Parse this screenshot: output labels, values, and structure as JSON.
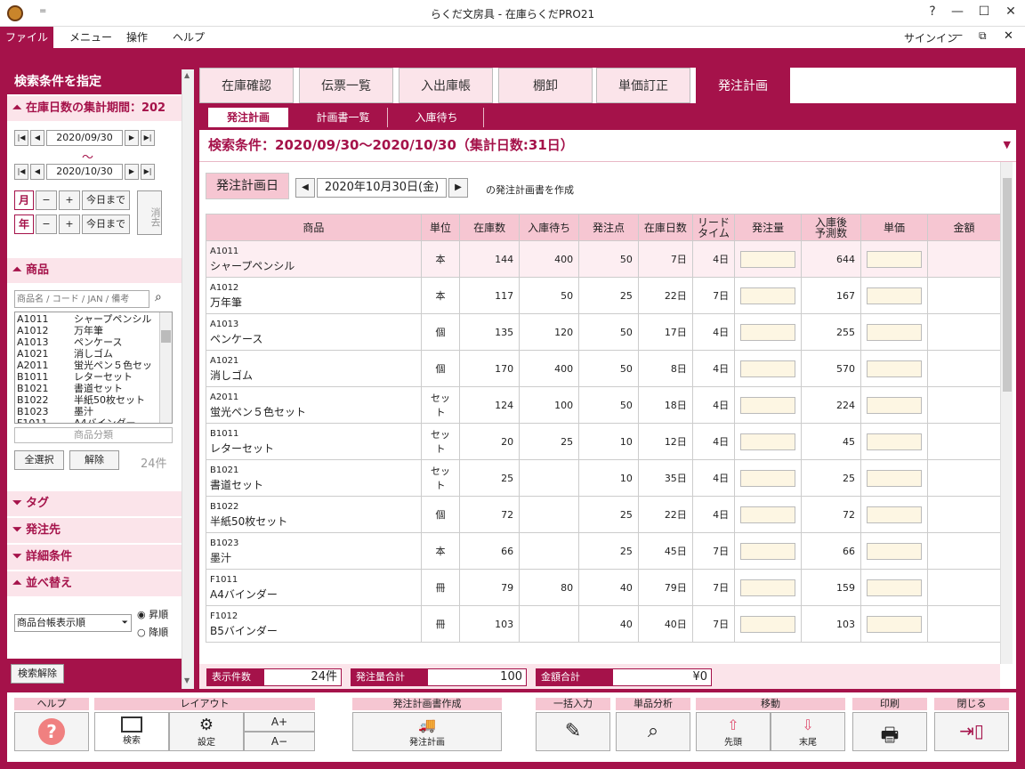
{
  "window": {
    "title": "らくだ文房具 - 在庫らくだPRO21",
    "signin": "サインイン",
    "help": "?",
    "minimize": "—",
    "maximize": "☐",
    "close": "✕",
    "restore": "⧉",
    "qa": "="
  },
  "menubar": {
    "items": [
      "ファイル",
      "メニュー",
      "操作",
      "ヘルプ"
    ]
  },
  "left": {
    "header": "検索条件を指定",
    "period_title": "在庫日数の集計期間：202",
    "date_from": "2020/09/30",
    "date_to": "2020/10/30",
    "tilde": "～",
    "month": "月",
    "year": "年",
    "minus": "−",
    "plus": "+",
    "today": "今日まで",
    "clear": "消去",
    "product_title": "商品",
    "search_placeholder": "商品名 / コード / JAN / 備考",
    "products": [
      [
        "A1011",
        "シャープペンシル"
      ],
      [
        "A1012",
        "万年筆"
      ],
      [
        "A1013",
        "ペンケース"
      ],
      [
        "A1021",
        "消しゴム"
      ],
      [
        "A2011",
        "蛍光ペン５色セッ"
      ],
      [
        "B1011",
        "レターセット"
      ],
      [
        "B1021",
        "書道セット"
      ],
      [
        "B1022",
        "半紙50枚セット"
      ],
      [
        "B1023",
        "墨汁"
      ],
      [
        "F1011",
        "A4バインダー"
      ]
    ],
    "category_placeholder": "商品分類",
    "select_all": "全選択",
    "release": "解除",
    "count": "24件",
    "tag": "タグ",
    "supplier": "発注先",
    "detail": "詳細条件",
    "sort": "並べ替え",
    "sort_value": "商品台帳表示順",
    "asc": "昇順",
    "desc": "降順",
    "reset_search": "検索解除"
  },
  "tabs": [
    "在庫確認",
    "伝票一覧",
    "入出庫帳",
    "棚卸",
    "単価訂正",
    "発注計画"
  ],
  "subtabs": [
    "発注計画",
    "計画書一覧",
    "入庫待ち"
  ],
  "condition": "検索条件：2020/09/30～2020/10/30（集計日数:31日）",
  "plan": {
    "label": "発注計画日",
    "date": "2020年10月30日(金)",
    "suffix": "の発注計画書を作成"
  },
  "table": {
    "headers": [
      "商品",
      "単位",
      "在庫数",
      "入庫待ち",
      "発注点",
      "在庫日数",
      "リード\nタイム",
      "発注量",
      "入庫後\n予測数",
      "単価",
      "金額"
    ],
    "rows": [
      {
        "code": "A1011",
        "name": "シャープペンシル",
        "unit": "本",
        "stock": "144",
        "wait": "400",
        "point": "50",
        "days": "7日",
        "lead": "4日",
        "forecast": "644"
      },
      {
        "code": "A1012",
        "name": "万年筆",
        "unit": "本",
        "stock": "117",
        "wait": "50",
        "point": "25",
        "days": "22日",
        "lead": "7日",
        "forecast": "167"
      },
      {
        "code": "A1013",
        "name": "ペンケース",
        "unit": "個",
        "stock": "135",
        "wait": "120",
        "point": "50",
        "days": "17日",
        "lead": "4日",
        "forecast": "255"
      },
      {
        "code": "A1021",
        "name": "消しゴム",
        "unit": "個",
        "stock": "170",
        "wait": "400",
        "point": "50",
        "days": "8日",
        "lead": "4日",
        "forecast": "570"
      },
      {
        "code": "A2011",
        "name": "蛍光ペン５色セット",
        "unit": "セット",
        "stock": "124",
        "wait": "100",
        "point": "50",
        "days": "18日",
        "lead": "4日",
        "forecast": "224"
      },
      {
        "code": "B1011",
        "name": "レターセット",
        "unit": "セット",
        "stock": "20",
        "wait": "25",
        "point": "10",
        "days": "12日",
        "lead": "4日",
        "forecast": "45"
      },
      {
        "code": "B1021",
        "name": "書道セット",
        "unit": "セット",
        "stock": "25",
        "wait": "",
        "point": "10",
        "days": "35日",
        "lead": "4日",
        "forecast": "25"
      },
      {
        "code": "B1022",
        "name": "半紙50枚セット",
        "unit": "個",
        "stock": "72",
        "wait": "",
        "point": "25",
        "days": "22日",
        "lead": "4日",
        "forecast": "72"
      },
      {
        "code": "B1023",
        "name": "墨汁",
        "unit": "本",
        "stock": "66",
        "wait": "",
        "point": "25",
        "days": "45日",
        "lead": "7日",
        "forecast": "66"
      },
      {
        "code": "F1011",
        "name": "A4バインダー",
        "unit": "冊",
        "stock": "79",
        "wait": "80",
        "point": "40",
        "days": "79日",
        "lead": "7日",
        "forecast": "159"
      },
      {
        "code": "F1012",
        "name": "B5バインダー",
        "unit": "冊",
        "stock": "103",
        "wait": "",
        "point": "40",
        "days": "40日",
        "lead": "7日",
        "forecast": "103"
      }
    ]
  },
  "status": {
    "count_label": "表示件数",
    "count": "24件",
    "qty_label": "発注量合計",
    "qty": "100",
    "amount_label": "金額合計",
    "amount": "¥0"
  },
  "bottom": {
    "help_group": "ヘルプ",
    "layout_group": "レイアウト",
    "create_group": "発注計画書作成",
    "bulk_group": "一括入力",
    "analysis_group": "単品分析",
    "move_group": "移動",
    "print_group": "印刷",
    "close_group": "閉じる",
    "search_btn": "検索",
    "settings_btn": "設定",
    "font_up": "A+",
    "font_down": "A−",
    "plan_btn": "発注計画",
    "first_btn": "先頭",
    "last_btn": "末尾"
  }
}
